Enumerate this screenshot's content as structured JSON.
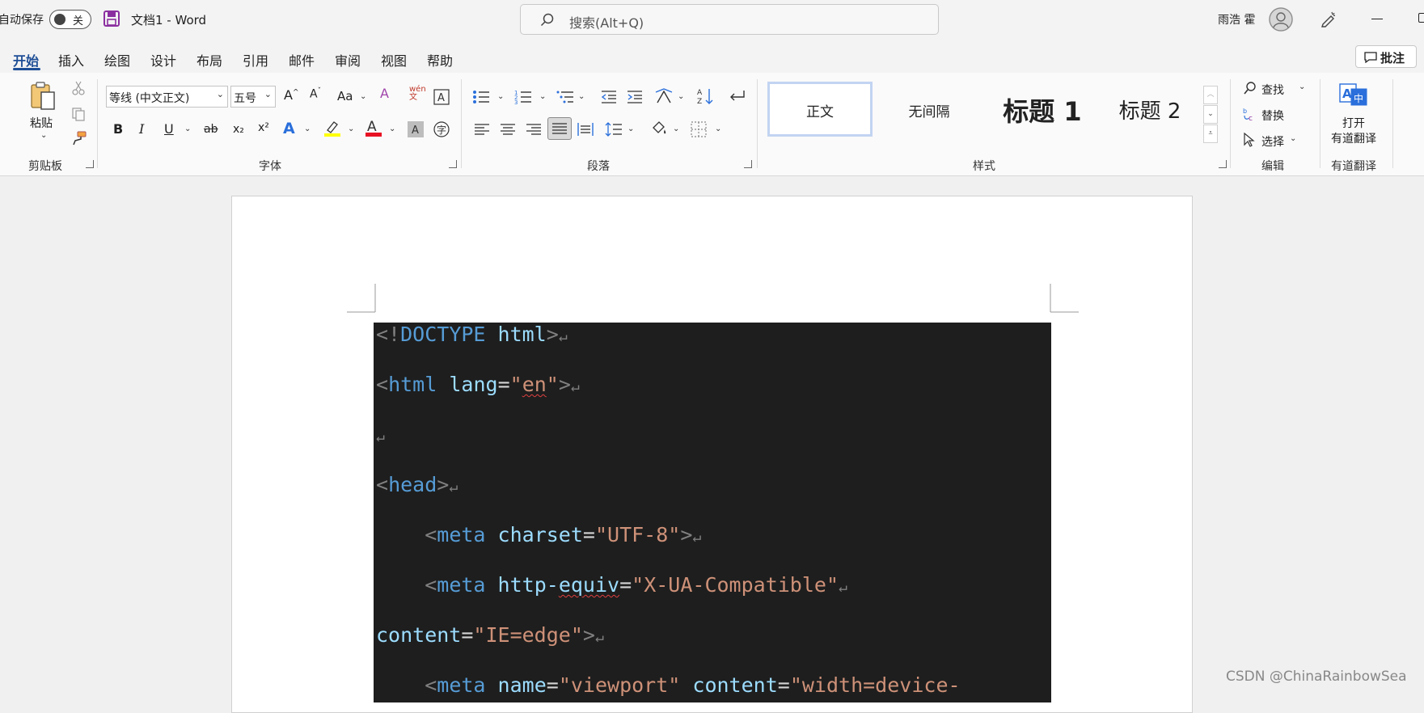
{
  "titlebar": {
    "autosave_label": "自动保存",
    "autosave_state": "关",
    "doc_title": "文档1  -  Word",
    "search_placeholder": "搜索(Alt+Q)",
    "user_name": "雨浩 霍"
  },
  "tabs": [
    {
      "label": "开始",
      "active": true
    },
    {
      "label": "插入"
    },
    {
      "label": "绘图"
    },
    {
      "label": "设计"
    },
    {
      "label": "布局"
    },
    {
      "label": "引用"
    },
    {
      "label": "邮件"
    },
    {
      "label": "审阅"
    },
    {
      "label": "视图"
    },
    {
      "label": "帮助"
    }
  ],
  "comment_button": "批注",
  "ribbon": {
    "clipboard": {
      "paste_label": "粘贴",
      "group_label": "剪贴板"
    },
    "font": {
      "font_name": "等线 (中文正文)",
      "font_size": "五号",
      "group_label": "字体",
      "grow": "A^",
      "shrink": "A˅",
      "change_case": "Aa",
      "bold": "B",
      "italic": "I",
      "underline": "U",
      "strike": "ab",
      "subscript": "x₂",
      "superscript": "x²",
      "highlight_color": "#ffff00",
      "font_color": "#e81123"
    },
    "paragraph": {
      "group_label": "段落"
    },
    "styles": {
      "group_label": "样式",
      "items": [
        {
          "label": "正文",
          "selected": true
        },
        {
          "label": "无间隔"
        },
        {
          "label": "标题 1"
        },
        {
          "label": "标题 2"
        }
      ]
    },
    "editing": {
      "find": "查找",
      "replace": "替换",
      "select": "选择",
      "group_label": "编辑"
    },
    "translate": {
      "button_line1": "打开",
      "button_line2": "有道翻译",
      "group_label": "有道翻译"
    }
  },
  "document": {
    "code_lines": [
      [
        {
          "t": "<!",
          "c": "b"
        },
        {
          "t": "DOCTYPE",
          "c": "k"
        },
        {
          "t": " ",
          "c": "t"
        },
        {
          "t": "html",
          "c": "a"
        },
        {
          "t": ">",
          "c": "b"
        }
      ],
      [
        {
          "t": "<",
          "c": "b"
        },
        {
          "t": "html",
          "c": "k"
        },
        {
          "t": " ",
          "c": "t"
        },
        {
          "t": "lang",
          "c": "a"
        },
        {
          "t": "=",
          "c": "t"
        },
        {
          "t": "\"",
          "c": "s"
        },
        {
          "t": "en",
          "c": "s",
          "sq": true
        },
        {
          "t": "\"",
          "c": "s"
        },
        {
          "t": ">",
          "c": "b"
        }
      ],
      [],
      [
        {
          "t": "<",
          "c": "b"
        },
        {
          "t": "head",
          "c": "k"
        },
        {
          "t": ">",
          "c": "b"
        }
      ],
      [
        {
          "t": "    <",
          "c": "b"
        },
        {
          "t": "meta",
          "c": "k"
        },
        {
          "t": " ",
          "c": "t"
        },
        {
          "t": "charset",
          "c": "a"
        },
        {
          "t": "=",
          "c": "t"
        },
        {
          "t": "\"UTF-8\"",
          "c": "s"
        },
        {
          "t": ">",
          "c": "b"
        }
      ],
      [
        {
          "t": "    <",
          "c": "b"
        },
        {
          "t": "meta",
          "c": "k"
        },
        {
          "t": " ",
          "c": "t"
        },
        {
          "t": "http-",
          "c": "a"
        },
        {
          "t": "equiv",
          "c": "a",
          "sq": true
        },
        {
          "t": "=",
          "c": "t"
        },
        {
          "t": "\"X-UA-Compatible\"",
          "c": "s"
        }
      ],
      [
        {
          "t": "content",
          "c": "a"
        },
        {
          "t": "=",
          "c": "t"
        },
        {
          "t": "\"IE=edge\"",
          "c": "s"
        },
        {
          "t": ">",
          "c": "b"
        }
      ],
      [
        {
          "t": "    <",
          "c": "b"
        },
        {
          "t": "meta",
          "c": "k"
        },
        {
          "t": " ",
          "c": "t"
        },
        {
          "t": "name",
          "c": "a"
        },
        {
          "t": "=",
          "c": "t"
        },
        {
          "t": "\"viewport\"",
          "c": "s"
        },
        {
          "t": " ",
          "c": "t"
        },
        {
          "t": "content",
          "c": "a"
        },
        {
          "t": "=",
          "c": "t"
        },
        {
          "t": "\"width=device-",
          "c": "s"
        }
      ]
    ],
    "pilcrow": "↵",
    "code_colors": {
      "b": "#808080",
      "k": "#569cd6",
      "a": "#9cdcfe",
      "s": "#ce9178",
      "t": "#d4d4d4"
    }
  },
  "watermark": "CSDN @ChinaRainbowSea"
}
